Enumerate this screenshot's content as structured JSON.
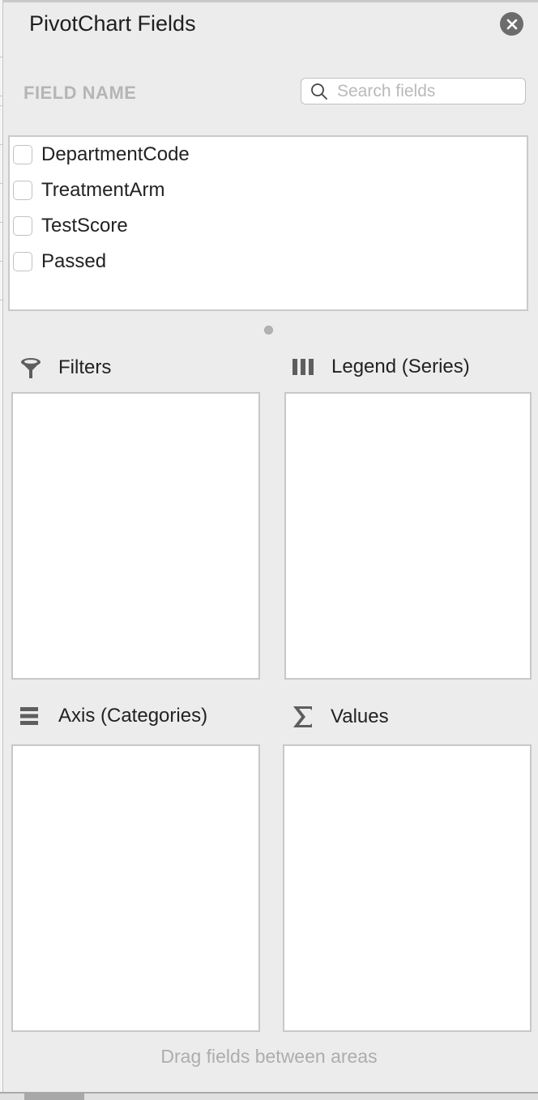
{
  "panel": {
    "title": "PivotChart Fields",
    "close_icon": "close-circle-icon"
  },
  "field_section": {
    "header": "FIELD NAME",
    "search": {
      "placeholder": "Search fields",
      "value": "",
      "icon": "search-icon"
    },
    "fields": [
      {
        "label": "DepartmentCode",
        "checked": false
      },
      {
        "label": "TreatmentArm",
        "checked": false
      },
      {
        "label": "TestScore",
        "checked": false
      },
      {
        "label": "Passed",
        "checked": false
      }
    ]
  },
  "areas": {
    "filters": {
      "label": "Filters",
      "icon": "filter-funnel-icon",
      "items": []
    },
    "legend": {
      "label": "Legend (Series)",
      "icon": "legend-columns-icon",
      "items": []
    },
    "axis": {
      "label": "Axis (Categories)",
      "icon": "axis-rows-icon",
      "items": []
    },
    "values": {
      "label": "Values",
      "icon": "sigma-icon",
      "items": []
    }
  },
  "footer": {
    "hint": "Drag fields between areas"
  },
  "colors": {
    "panel_bg": "#ececec",
    "close_button": "#6c6c6c",
    "muted_text": "#b5b5b5"
  }
}
